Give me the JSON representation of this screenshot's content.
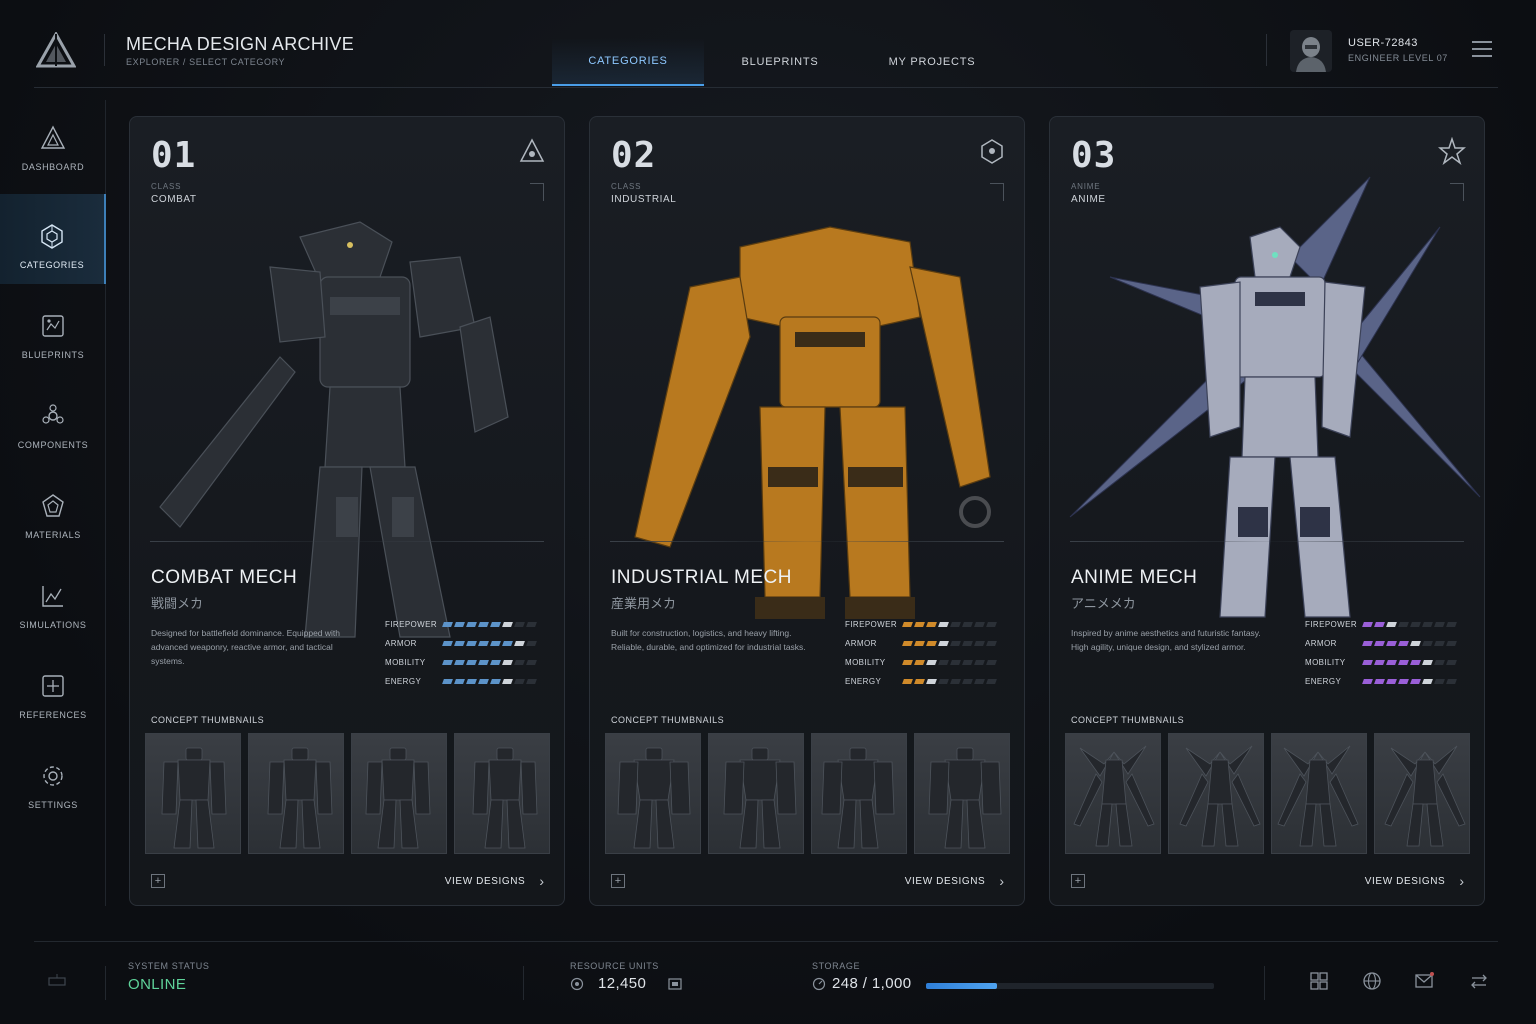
{
  "header": {
    "app_title": "MECHA DESIGN ARCHIVE",
    "breadcrumb": "EXPLORER / SELECT CATEGORY",
    "tabs": [
      {
        "label": "CATEGORIES",
        "active": true
      },
      {
        "label": "BLUEPRINTS",
        "active": false
      },
      {
        "label": "MY PROJECTS",
        "active": false
      }
    ],
    "user": {
      "name": "USER-72843",
      "level": "ENGINEER LEVEL 07"
    }
  },
  "sidebar": {
    "items": [
      {
        "label": "DASHBOARD",
        "icon": "dashboard-icon",
        "active": false
      },
      {
        "label": "CATEGORIES",
        "icon": "categories-icon",
        "active": true
      },
      {
        "label": "BLUEPRINTS",
        "icon": "blueprints-icon",
        "active": false
      },
      {
        "label": "COMPONENTS",
        "icon": "components-icon",
        "active": false
      },
      {
        "label": "MATERIALS",
        "icon": "materials-icon",
        "active": false
      },
      {
        "label": "SIMULATIONS",
        "icon": "simulations-icon",
        "active": false
      },
      {
        "label": "REFERENCES",
        "icon": "references-icon",
        "active": false
      },
      {
        "label": "SETTINGS",
        "icon": "settings-icon",
        "active": false
      }
    ]
  },
  "cards": [
    {
      "num": "01",
      "class_label": "CLASS",
      "class": "COMBAT",
      "title": "COMBAT MECH",
      "jp": "戦闘メカ",
      "desc": "Designed for battlefield dominance. Equipped with advanced weaponry, reactive armor, and tactical systems.",
      "accent": "#5c93c9",
      "stats": [
        {
          "name": "FIREPOWER",
          "value": 6
        },
        {
          "name": "ARMOR",
          "value": 7
        },
        {
          "name": "MOBILITY",
          "value": 6
        },
        {
          "name": "ENERGY",
          "value": 6
        }
      ],
      "thumbs_label": "CONCEPT THUMBNAILS",
      "view_label": "VIEW DESIGNS"
    },
    {
      "num": "02",
      "class_label": "CLASS",
      "class": "INDUSTRIAL",
      "title": "INDUSTRIAL MECH",
      "jp": "産業用メカ",
      "desc": "Built for construction, logistics, and heavy lifting. Reliable, durable, and optimized for industrial tasks.",
      "accent": "#d08a2a",
      "stats": [
        {
          "name": "FIREPOWER",
          "value": 4
        },
        {
          "name": "ARMOR",
          "value": 4
        },
        {
          "name": "MOBILITY",
          "value": 3
        },
        {
          "name": "ENERGY",
          "value": 3
        }
      ],
      "thumbs_label": "CONCEPT THUMBNAILS",
      "view_label": "VIEW DESIGNS"
    },
    {
      "num": "03",
      "class_label": "ANIME",
      "class": "ANIME",
      "title": "ANIME MECH",
      "jp": "アニメメカ",
      "desc": "Inspired by anime aesthetics and futuristic fantasy. High agility, unique design, and stylized armor.",
      "accent": "#9a5fd8",
      "stats": [
        {
          "name": "FIREPOWER",
          "value": 3
        },
        {
          "name": "ARMOR",
          "value": 5
        },
        {
          "name": "MOBILITY",
          "value": 6
        },
        {
          "name": "ENERGY",
          "value": 6
        }
      ],
      "thumbs_label": "CONCEPT THUMBNAILS",
      "view_label": "VIEW DESIGNS"
    }
  ],
  "footer": {
    "status_label": "SYSTEM STATUS",
    "status_value": "ONLINE",
    "resource_label": "RESOURCE UNITS",
    "resource_value": "12,450",
    "storage_label": "STORAGE",
    "storage_value": "248 / 1,000",
    "storage_fraction": 0.248,
    "icons": [
      "grid-icon",
      "globe-icon",
      "mail-icon",
      "transfer-icon"
    ]
  },
  "colors": {
    "accent_blue": "#4a9ee8",
    "online_green": "#5fd39a",
    "background": "#0e1115"
  }
}
